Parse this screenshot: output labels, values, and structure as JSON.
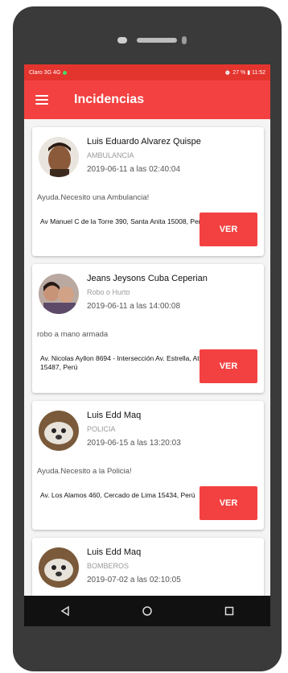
{
  "statusbar": {
    "left": "Claro 3G 4G",
    "right": "⏰ 27 % ▮ 11:52"
  },
  "appbar": {
    "title": "Incidencias"
  },
  "incidents": [
    {
      "name": "Luis Eduardo Alvarez Quispe",
      "category": "AMBULANCIA",
      "datetime": "2019-06-11 a las 02:40:04",
      "message": "Ayuda.Necesito una Ambulancia!",
      "address": "Av Manuel C de la Torre 390, Santa Anita 15008, Perú",
      "button": "VER"
    },
    {
      "name": "Jeans Jeysons Cuba Ceperian",
      "category": "Robo o Hurto",
      "datetime": "2019-06-11 a las 14:00:08",
      "message": "robo a mano armada",
      "address": "Av. Nicolas Ayllon 8694 - Intersección Av. Estrella, Ate 15487, Perú",
      "button": "VER"
    },
    {
      "name": "Luis Edd Maq",
      "category": "POLICIA",
      "datetime": "2019-06-15 a las 13:20:03",
      "message": "Ayuda.Necesito a la Policia!",
      "address": "Av. Los Alamos 460, Cercado de Lima 15434, Perú",
      "button": "VER"
    },
    {
      "name": "Luis Edd Maq",
      "category": "BOMBEROS",
      "datetime": "2019-07-02 a las 02:10:05",
      "message": "",
      "address": "",
      "button": ""
    }
  ],
  "colors": {
    "accent": "#f24140",
    "statusbar": "#e4342e"
  },
  "navbar": {
    "back_icon": "back-triangle-icon",
    "home_icon": "home-circle-icon",
    "recents_icon": "recents-square-icon"
  }
}
